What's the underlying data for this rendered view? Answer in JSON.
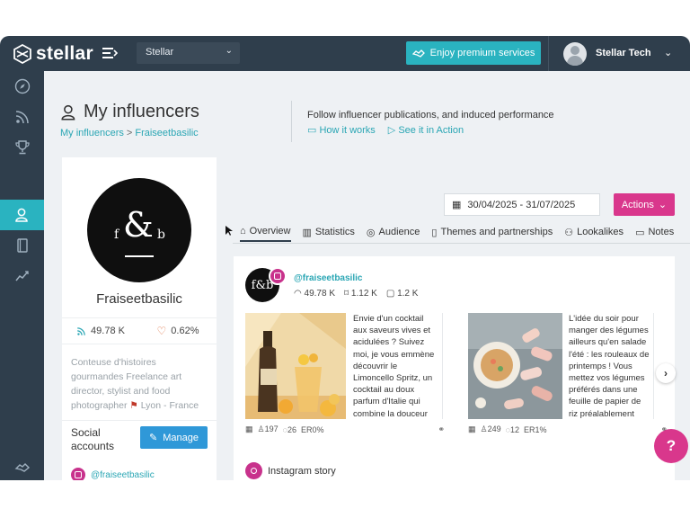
{
  "topbar": {
    "brand": "stellar",
    "workspace": "Stellar",
    "premium_label": "Enjoy premium services",
    "user_name": "Stellar Tech"
  },
  "sidebar": {
    "items": [
      {
        "icon": "compass-icon"
      },
      {
        "icon": "rss-icon"
      },
      {
        "icon": "trophy-icon"
      },
      {
        "icon": "influencer-icon",
        "active": true
      },
      {
        "icon": "notebook-icon"
      },
      {
        "icon": "chart-line-icon"
      },
      {
        "icon": "handshake-icon"
      },
      {
        "icon": "help-circle-icon"
      }
    ]
  },
  "page": {
    "title": "My influencers",
    "breadcrumb": [
      "My influencers",
      "Fraiseetbasilic"
    ],
    "description": "Follow influencer publications, and induced performance",
    "how_it_works": "How it works",
    "see_in_action": "See it in Action"
  },
  "profile": {
    "logo_amp": "&",
    "logo_f": "f",
    "logo_b": "b",
    "name": "Fraiseetbasilic",
    "followers": "49.78 K",
    "engagement": "0.62%",
    "bio": "Conteuse d'histoires gourmandes Freelance art director, stylist and food photographer",
    "location": "Lyon - France",
    "social_accounts_label": "Social accounts",
    "manage_label": "Manage",
    "instagram_handle": "@fraiseetbasilic"
  },
  "toolbar": {
    "date_range": "30/04/2025 - 31/07/2025",
    "actions_label": "Actions"
  },
  "tabs": [
    {
      "label": "Overview",
      "icon": "home-icon",
      "active": true
    },
    {
      "label": "Statistics",
      "icon": "bar-chart-icon"
    },
    {
      "label": "Audience",
      "icon": "audience-icon"
    },
    {
      "label": "Themes and partnerships",
      "icon": "book-icon"
    },
    {
      "label": "Lookalikes",
      "icon": "lookalike-icon"
    },
    {
      "label": "Notes",
      "icon": "note-icon"
    }
  ],
  "account": {
    "avatar_text": "f&b",
    "handle": "@fraiseetbasilic",
    "followers": "49.78 K",
    "saved": "1.12 K",
    "posts": "1.2 K"
  },
  "posts": [
    {
      "text": "Envie d'un cocktail aux saveurs vives et acidulées ? Suivez moi, je vous emmène découvrir le Limoncello Spritz, un cocktail au doux parfum d'Italie qui combine la douceur du Limoncello, une liqueur de citron sucrée, à la fraîcheur du",
      "likes": "197",
      "comments": "26",
      "er": "ER0%"
    },
    {
      "text": "L'idée du soir pour manger des légumes ailleurs qu'en salade l'été : les rouleaux de printemps ! Vous mettez vos légumes préférés dans une feuille de papier de riz préalablement trempée dans de l'eau froide, vous pliez les bords puis",
      "likes": "249",
      "comments": "12",
      "er": "ER1%"
    }
  ],
  "story": {
    "label": "Instagram story"
  },
  "help_label": "?",
  "next_label": "›",
  "colors": {
    "dark_nav": "#2f3e4c",
    "accent_teal": "#2ab3c0",
    "accent_pink": "#d9378c",
    "link_blue": "#2aa6b4",
    "manage_blue": "#2f98d8"
  }
}
